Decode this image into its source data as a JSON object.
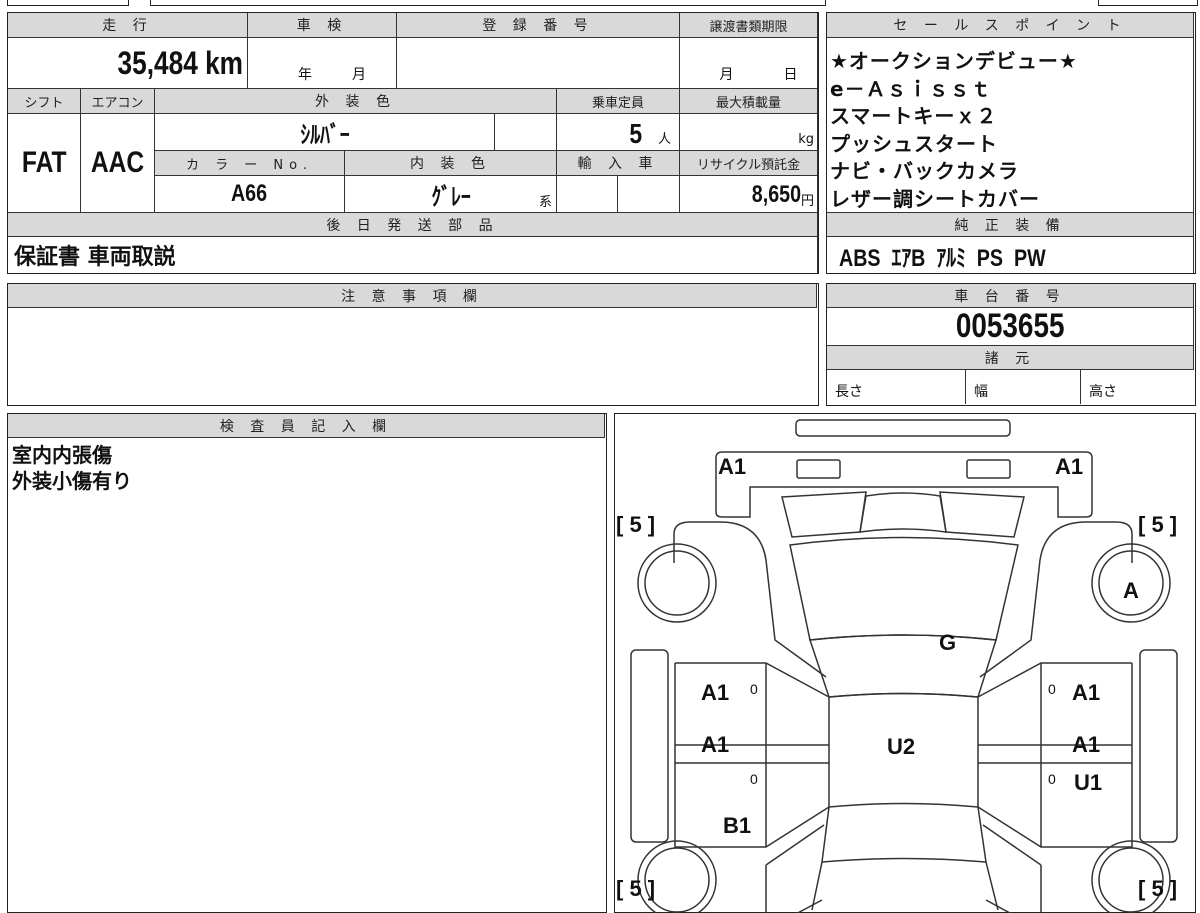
{
  "vehicle": {
    "mileage_label": "走 行",
    "mileage_value": "35,484 km",
    "inspection_label": "車 検",
    "inspection_year": "年",
    "inspection_month": "月",
    "registration_label": "登 録 番 号",
    "transfer_deadline_label": "譲渡書類期限",
    "transfer_month": "月",
    "transfer_day": "日",
    "shift_label": "シフト",
    "shift_value": "FAT",
    "ac_label": "エアコン",
    "ac_value": "AAC",
    "exterior_color_label": "外 装 色",
    "exterior_color_value": "ｼﾙﾊﾞｰ",
    "capacity_label": "乗車定員",
    "capacity_value": "5",
    "capacity_unit": "人",
    "max_load_label": "最大積載量",
    "max_load_unit": "kg",
    "color_no_label": "カ ラ ー No.",
    "color_no_value": "A66",
    "interior_color_label": "内 装 色",
    "interior_color_value": "ｸﾞﾚｰ",
    "interior_color_suffix": "系",
    "import_label": "輸 入 車",
    "recycle_label": "リサイクル預託金",
    "recycle_value": "8,650",
    "recycle_unit": "円",
    "later_parts_label": "後 日 発 送 部 品",
    "later_parts_value": "保証書 車両取説"
  },
  "sales_points": {
    "label": "セ ー ル ス ポ イ ン ト",
    "items": [
      "★オークションデビュー★",
      "e－Ａｓｉｓｓｔ",
      "スマートキーｘ２",
      "プッシュスタート",
      "ナビ・バックカメラ",
      "レザー調シートカバー"
    ],
    "equipment_label": "純 正 装 備",
    "equipment_value": "ABS  ｴｱB  ｱﾙﾐ  PS  PW"
  },
  "notes": {
    "label": "注 意 事 項 欄"
  },
  "chassis": {
    "label": "車 台 番 号",
    "value": "0053655",
    "spec_label": "諸 元",
    "length_label": "長さ",
    "width_label": "幅",
    "height_label": "高さ"
  },
  "inspector": {
    "label": "検 査 員 記 入 欄",
    "lines": [
      "室内内張傷",
      "外装小傷有り"
    ]
  },
  "diagram": {
    "front_left": "A1",
    "front_right": "A1",
    "bracket_fl": "[ 5 ]",
    "bracket_fr": "[ 5 ]",
    "bracket_rl": "[ 5 ]",
    "bracket_rr": "[ 5 ]",
    "wheel_fr": "A",
    "hood": "G",
    "roof": "U2",
    "door_fl": "A1",
    "door_fr": "A1",
    "door_rl": "A1",
    "door_rr": "A1",
    "door_rr_2": "U1",
    "quarter_rl": "B1",
    "mark_fl": "0",
    "mark_fr": "0",
    "mark_rl": "0",
    "mark_rr": "0"
  }
}
